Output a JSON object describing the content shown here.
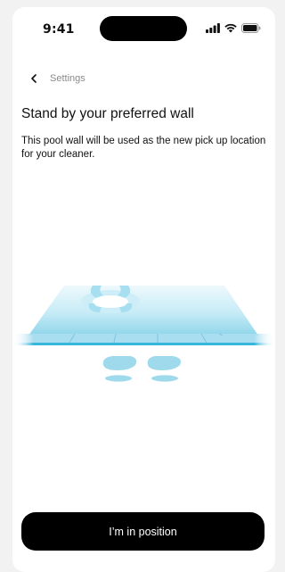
{
  "status_bar": {
    "time": "9:41",
    "icons": [
      "signal-icon",
      "wifi-icon",
      "battery-icon"
    ]
  },
  "header": {
    "back_icon": "chevron-left-icon",
    "title": "Settings"
  },
  "main": {
    "title": "Stand by your preferred wall",
    "description": "This pool wall will be used as the new pick up location for your cleaner.",
    "illustration": {
      "elements": [
        "lifebuoy",
        "pool-floor",
        "pool-wall",
        "footprints"
      ]
    }
  },
  "footer": {
    "cta_label": "I’m in position"
  },
  "colors": {
    "background": "#ffffff",
    "text": "#111111",
    "muted": "#8a8a8a",
    "button": "#000000",
    "button_text": "#ffffff",
    "pool_light": "#d8f0f8",
    "pool_mid": "#9fdaec",
    "pool_edge": "#38b6dc"
  }
}
